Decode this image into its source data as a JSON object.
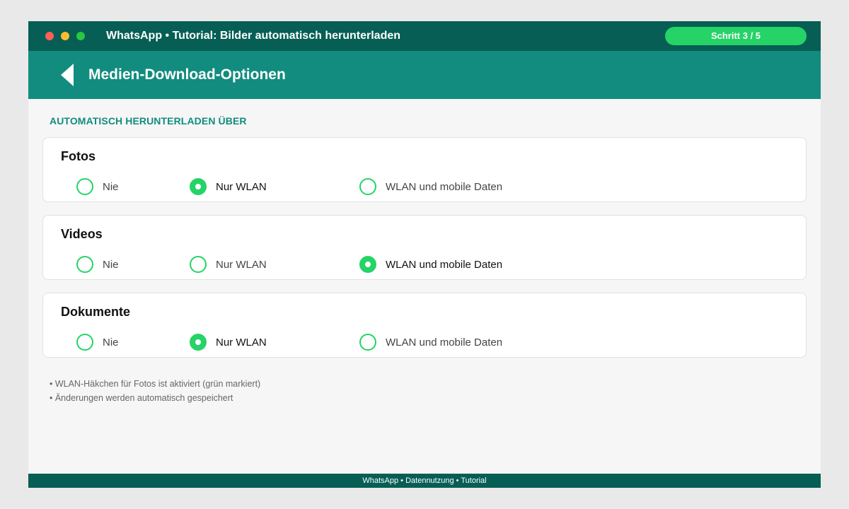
{
  "window": {
    "title": "WhatsApp • Tutorial: Bilder automatisch herunterladen",
    "step": "Schritt 3 / 5",
    "controls": [
      "close",
      "minimize",
      "maximize"
    ]
  },
  "appbar": {
    "back_icon": "back-arrow-icon",
    "title": "Medien-Download-Optionen"
  },
  "section_heading": "AUTOMATISCH HERUNTERLADEN ÜBER",
  "media_types": [
    {
      "title": "Fotos",
      "options": [
        {
          "label": "Nie",
          "selected": false
        },
        {
          "label": "Nur WLAN",
          "selected": true
        },
        {
          "label": "WLAN und mobile Daten",
          "selected": false
        }
      ]
    },
    {
      "title": "Videos",
      "options": [
        {
          "label": "Nie",
          "selected": false
        },
        {
          "label": "Nur WLAN",
          "selected": false
        },
        {
          "label": "WLAN und mobile Daten",
          "selected": true
        }
      ]
    },
    {
      "title": "Dokumente",
      "options": [
        {
          "label": "Nie",
          "selected": false
        },
        {
          "label": "Nur WLAN",
          "selected": true
        },
        {
          "label": "WLAN und mobile Daten",
          "selected": false
        }
      ]
    }
  ],
  "notes": [
    "• WLAN-Häkchen für Fotos ist aktiviert (grün markiert)",
    "• Änderungen werden automatisch gespeichert"
  ],
  "footer": "WhatsApp • Datennutzung • Tutorial",
  "colors": {
    "titlebar": "#075e54",
    "appbar": "#128c7e",
    "accent": "#25d366",
    "background": "#f6f6f6"
  }
}
